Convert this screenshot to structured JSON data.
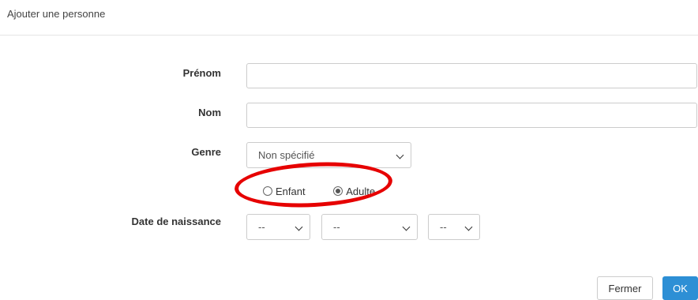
{
  "modal": {
    "title": "Ajouter une personne"
  },
  "form": {
    "first_name_label": "Prénom",
    "first_name_value": "",
    "last_name_label": "Nom",
    "last_name_value": "",
    "gender_label": "Genre",
    "gender_selected": "Non spécifié",
    "age_options": [
      {
        "label": "Enfant",
        "checked": false
      },
      {
        "label": "Adulte",
        "checked": true
      }
    ],
    "birthdate_label": "Date de naissance",
    "birth_day_selected": "--",
    "birth_month_selected": "--",
    "birth_year_selected": "--"
  },
  "footer": {
    "close_label": "Fermer",
    "ok_label": "OK"
  },
  "colors": {
    "primary": "#2d8fd5",
    "annotation": "#e60000"
  }
}
